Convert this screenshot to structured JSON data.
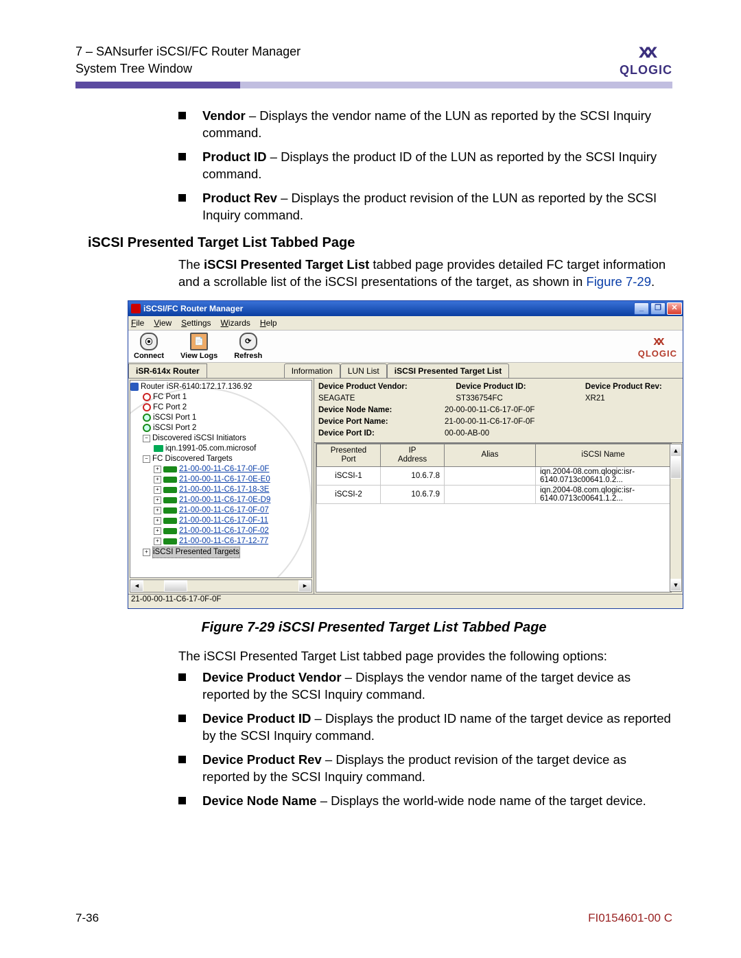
{
  "header": {
    "line1": "7 – SANsurfer iSCSI/FC Router Manager",
    "line2": "System Tree Window",
    "logo_word": "QLOGIC"
  },
  "top_bullets": [
    {
      "bold": "Vendor",
      "rest": " – Displays the vendor name of the LUN as reported by the SCSI Inquiry command."
    },
    {
      "bold": "Product ID",
      "rest": " – Displays the product ID of the LUN as reported by the SCSI Inquiry command."
    },
    {
      "bold": "Product Rev",
      "rest": " – Displays the product revision of the LUN as reported by the SCSI Inquiry command."
    }
  ],
  "section_heading": "iSCSI Presented Target List Tabbed Page",
  "section_para_parts": {
    "pre": "The ",
    "bold": "iSCSI Presented Target List",
    "mid": " tabbed page provides detailed FC target information and a scrollable list of the iSCSI presentations of the target, as shown in ",
    "link": "Figure 7-29",
    "post": "."
  },
  "figure_caption": "Figure 7-29  iSCSI Presented Target List Tabbed Page",
  "after_fig_para": "The iSCSI Presented Target List tabbed page provides the following options:",
  "after_bullets": [
    {
      "bold": "Device Product Vendor",
      "rest": " – Displays the vendor name of the target device as reported by the SCSI Inquiry command."
    },
    {
      "bold": "Device Product ID",
      "rest": " – Displays the product ID name of the target device as reported by the SCSI Inquiry command."
    },
    {
      "bold": "Device Product Rev",
      "rest": " – Displays the product revision of the target device as reported by the SCSI Inquiry command."
    },
    {
      "bold": "Device Node Name",
      "rest": " – Displays the world-wide node name of the target device."
    }
  ],
  "footer": {
    "page": "7-36",
    "doc": "FI0154601-00  C"
  },
  "app": {
    "title": "iSCSI/FC Router Manager",
    "menu": [
      "File",
      "View",
      "Settings",
      "Wizards",
      "Help"
    ],
    "toolbar": [
      {
        "name": "connect-button",
        "label": "Connect"
      },
      {
        "name": "viewlogs-button",
        "label": "View Logs"
      },
      {
        "name": "refresh-button",
        "label": "Refresh"
      }
    ],
    "toolbar_logo": "QLOGIC",
    "left_tab": "iSR-614x Router",
    "tabs": [
      "Information",
      "LUN List",
      "iSCSI Presented Target List"
    ],
    "active_tab_index": 2,
    "tree": {
      "root": "Router iSR-6140:172.17.136.92",
      "ports": [
        "FC Port 1",
        "FC Port 2",
        "iSCSI Port 1",
        "iSCSI Port 2"
      ],
      "initiators_label": "Discovered iSCSI Initiators",
      "initiator": "iqn.1991-05.com.microsof",
      "fc_targets_label": "FC Discovered Targets",
      "targets": [
        "21-00-00-11-C6-17-0F-0F",
        "21-00-00-11-C6-17-0E-E0",
        "21-00-00-11-C6-17-18-3E",
        "21-00-00-11-C6-17-0E-D9",
        "21-00-00-11-C6-17-0F-07",
        "21-00-00-11-C6-17-0F-11",
        "21-00-00-11-C6-17-0F-02",
        "21-00-00-11-C6-17-12-77"
      ],
      "iscsi_presented_label": "iSCSI Presented Targets"
    },
    "dev_info": {
      "vendor_label": "Device Product Vendor:",
      "vendor": "SEAGATE",
      "pid_label": "Device Product ID:",
      "pid": "ST336754FC",
      "rev_label": "Device Product Rev:",
      "rev": "XR21",
      "nodename_label": "Device Node Name:",
      "nodename": "20-00-00-11-C6-17-0F-0F",
      "portname_label": "Device Port Name:",
      "portname": "21-00-00-11-C6-17-0F-0F",
      "portid_label": "Device Port ID:",
      "portid": "00-00-AB-00"
    },
    "grid": {
      "cols": [
        "Presented\nPort",
        "IP\nAddress",
        "Alias",
        "iSCSI Name"
      ],
      "rows": [
        {
          "port": "iSCSI-1",
          "ip": "10.6.7.8",
          "alias": "",
          "name": "iqn.2004-08.com.qlogic:isr-6140.0713c00641.0.2..."
        },
        {
          "port": "iSCSI-2",
          "ip": "10.6.7.9",
          "alias": "",
          "name": "iqn.2004-08.com.qlogic:isr-6140.0713c00641.1.2..."
        }
      ]
    },
    "statusbar": "21-00-00-11-C6-17-0F-0F"
  }
}
